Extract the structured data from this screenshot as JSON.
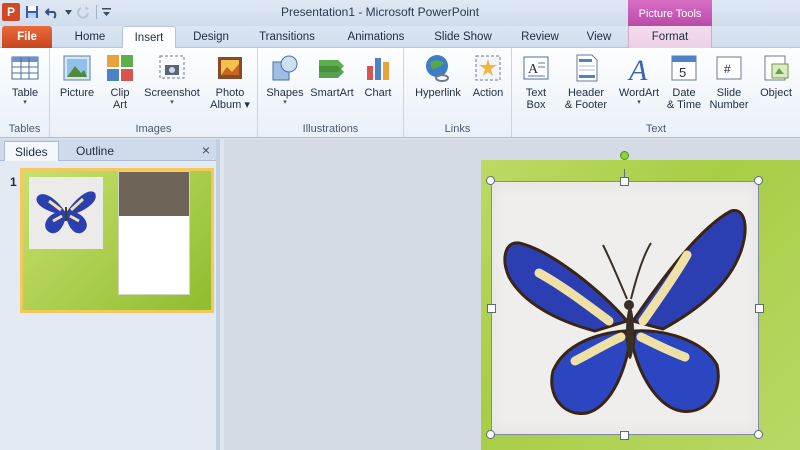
{
  "window": {
    "title": "Presentation1 - Microsoft PowerPoint",
    "contextual_header": "Picture Tools"
  },
  "quick_access": {
    "app_icon": "P"
  },
  "tabs": [
    {
      "label": "File"
    },
    {
      "label": "Home"
    },
    {
      "label": "Insert"
    },
    {
      "label": "Design"
    },
    {
      "label": "Transitions"
    },
    {
      "label": "Animations"
    },
    {
      "label": "Slide Show"
    },
    {
      "label": "Review"
    },
    {
      "label": "View"
    },
    {
      "label": "Format"
    }
  ],
  "ribbon": {
    "groups": [
      {
        "label": "Tables"
      },
      {
        "label": "Images"
      },
      {
        "label": "Illustrations"
      },
      {
        "label": "Links"
      },
      {
        "label": "Text"
      }
    ],
    "buttons": {
      "table": [
        "Table",
        "▾"
      ],
      "picture": [
        "Picture"
      ],
      "clipart": [
        "Clip",
        "Art"
      ],
      "screenshot": [
        "Screenshot",
        "▾"
      ],
      "photoalbum": [
        "Photo",
        "Album ▾"
      ],
      "shapes": [
        "Shapes",
        "▾"
      ],
      "smartart": [
        "SmartArt"
      ],
      "chart": [
        "Chart"
      ],
      "hyperlink": [
        "Hyperlink"
      ],
      "action": [
        "Action"
      ],
      "textbox": [
        "Text",
        "Box"
      ],
      "headerfooter": [
        "Header",
        "& Footer"
      ],
      "wordart": [
        "WordArt",
        "▾"
      ],
      "datetime": [
        "Date",
        "& Time"
      ],
      "slidenumber": [
        "Slide",
        "Number"
      ],
      "object": [
        "Object"
      ]
    }
  },
  "left_pane": {
    "tabs": [
      {
        "label": "Slides"
      },
      {
        "label": "Outline"
      }
    ],
    "close": "×",
    "slide_number": "1"
  },
  "colors": {
    "file_tab": "#d24726",
    "context_tab": "#c15bb3",
    "slide_green": "#a8cd45",
    "butterfly_blue": "#2a3fb0"
  }
}
